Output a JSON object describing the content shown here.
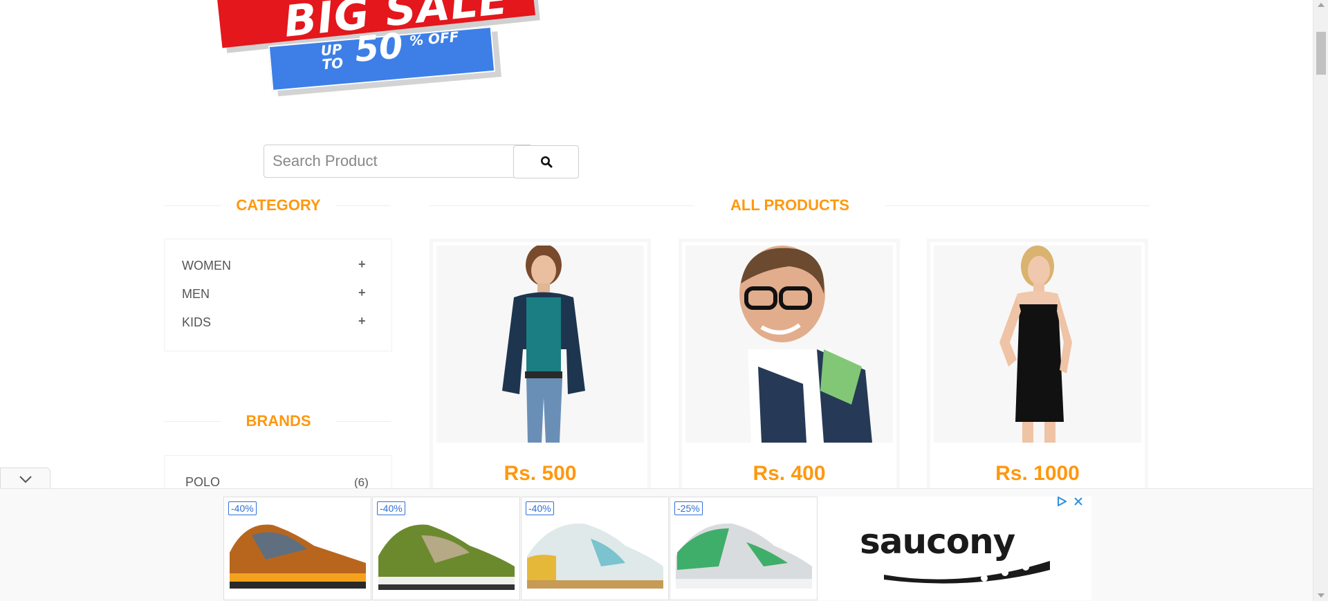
{
  "banner": {
    "headline": "BIG SALE",
    "upto": "UP TO",
    "percent": "50",
    "off": "% OFF"
  },
  "search": {
    "placeholder": "Search Product",
    "button_icon": "search-icon"
  },
  "sidebar": {
    "category_title": "CATEGORY",
    "categories": [
      {
        "label": "WOMEN",
        "icon": "plus-icon"
      },
      {
        "label": "MEN",
        "icon": "plus-icon"
      },
      {
        "label": "KIDS",
        "icon": "plus-icon"
      }
    ],
    "brands_title": "BRANDS",
    "brands": [
      {
        "label": "POLO",
        "count": "(6)"
      }
    ]
  },
  "main": {
    "title": "ALL PRODUCTS",
    "products": [
      {
        "price": "Rs. 500",
        "image": "woman-in-jacket"
      },
      {
        "price": "Rs. 400",
        "image": "man-with-glasses"
      },
      {
        "price": "Rs. 1000",
        "image": "woman-in-black-dress"
      }
    ]
  },
  "ad": {
    "shoes": [
      {
        "discount": "-40%",
        "color": "#b8661e"
      },
      {
        "discount": "-40%",
        "color": "#6b8a2e"
      },
      {
        "discount": "-40%",
        "color": "#dfe9ea"
      },
      {
        "discount": "-25%",
        "color": "#3fae6a"
      }
    ],
    "brand": "saucony",
    "info_icon": "adchoices-icon",
    "close_icon": "close-icon",
    "collapse_icon": "chevron-down-icon"
  },
  "colors": {
    "accent": "#FE980F",
    "banner_red": "#e3171c",
    "banner_blue": "#3d7fe6",
    "badge_blue": "#2f6fd6"
  }
}
